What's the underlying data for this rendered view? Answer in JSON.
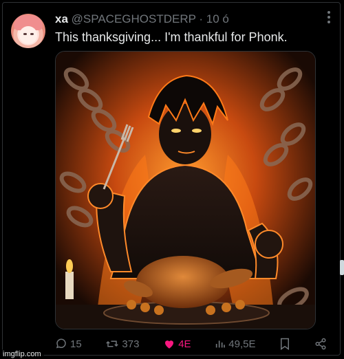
{
  "tweet": {
    "display_name": "xa",
    "handle": "@SPACEGHOSTDERP",
    "separator": "·",
    "time": "10 ó",
    "text": "This thanksgiving... I'm thankful for Phonk."
  },
  "media": {
    "description_icon": "image"
  },
  "actions": {
    "replies": "15",
    "reposts": "373",
    "likes": "4E",
    "views": "49,5E"
  },
  "icons": [
    "reply-icon",
    "repost-icon",
    "like-icon",
    "views-icon",
    "bookmark-icon",
    "share-icon",
    "more-icon"
  ],
  "colors": {
    "like_accent": "#f91880",
    "muted": "#71767b",
    "text": "#e7e9ea",
    "background": "#000000"
  },
  "watermark": "imgflip.com"
}
